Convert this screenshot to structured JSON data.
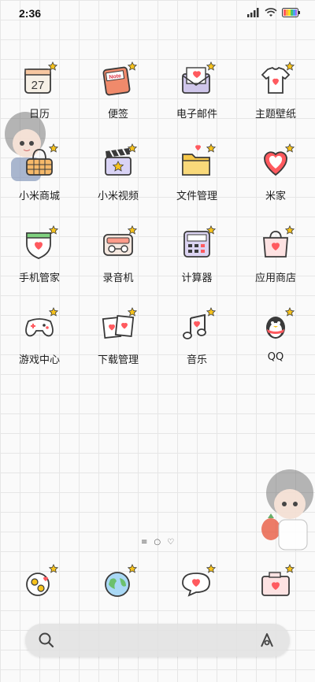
{
  "status_bar": {
    "time": "2:36"
  },
  "apps": [
    {
      "label": "日历",
      "icon": "calendar-icon",
      "day": "27"
    },
    {
      "label": "便签",
      "icon": "notes-icon",
      "note": "Note"
    },
    {
      "label": "电子邮件",
      "icon": "mail-icon"
    },
    {
      "label": "主题壁纸",
      "icon": "theme-tshirt-icon"
    },
    {
      "label": "小米商城",
      "icon": "shopping-basket-icon"
    },
    {
      "label": "小米视频",
      "icon": "video-clapper-icon"
    },
    {
      "label": "文件管理",
      "icon": "folder-icon"
    },
    {
      "label": "米家",
      "icon": "heart-home-icon"
    },
    {
      "label": "手机管家",
      "icon": "shield-icon"
    },
    {
      "label": "录音机",
      "icon": "recorder-icon"
    },
    {
      "label": "计算器",
      "icon": "calculator-icon"
    },
    {
      "label": "应用商店",
      "icon": "store-bag-icon"
    },
    {
      "label": "游戏中心",
      "icon": "gamepad-icon"
    },
    {
      "label": "下载管理",
      "icon": "download-icon"
    },
    {
      "label": "音乐",
      "icon": "music-icon"
    },
    {
      "label": "QQ",
      "icon": "qq-penguin-icon"
    }
  ],
  "dock": [
    {
      "icon": "phone-icon"
    },
    {
      "icon": "browser-globe-icon"
    },
    {
      "icon": "messages-icon"
    },
    {
      "icon": "camera-icon"
    }
  ],
  "colors": {
    "accent_red": "#ff5a5f",
    "star_yellow": "#f6c21c",
    "outline": "#3a3a3a"
  }
}
